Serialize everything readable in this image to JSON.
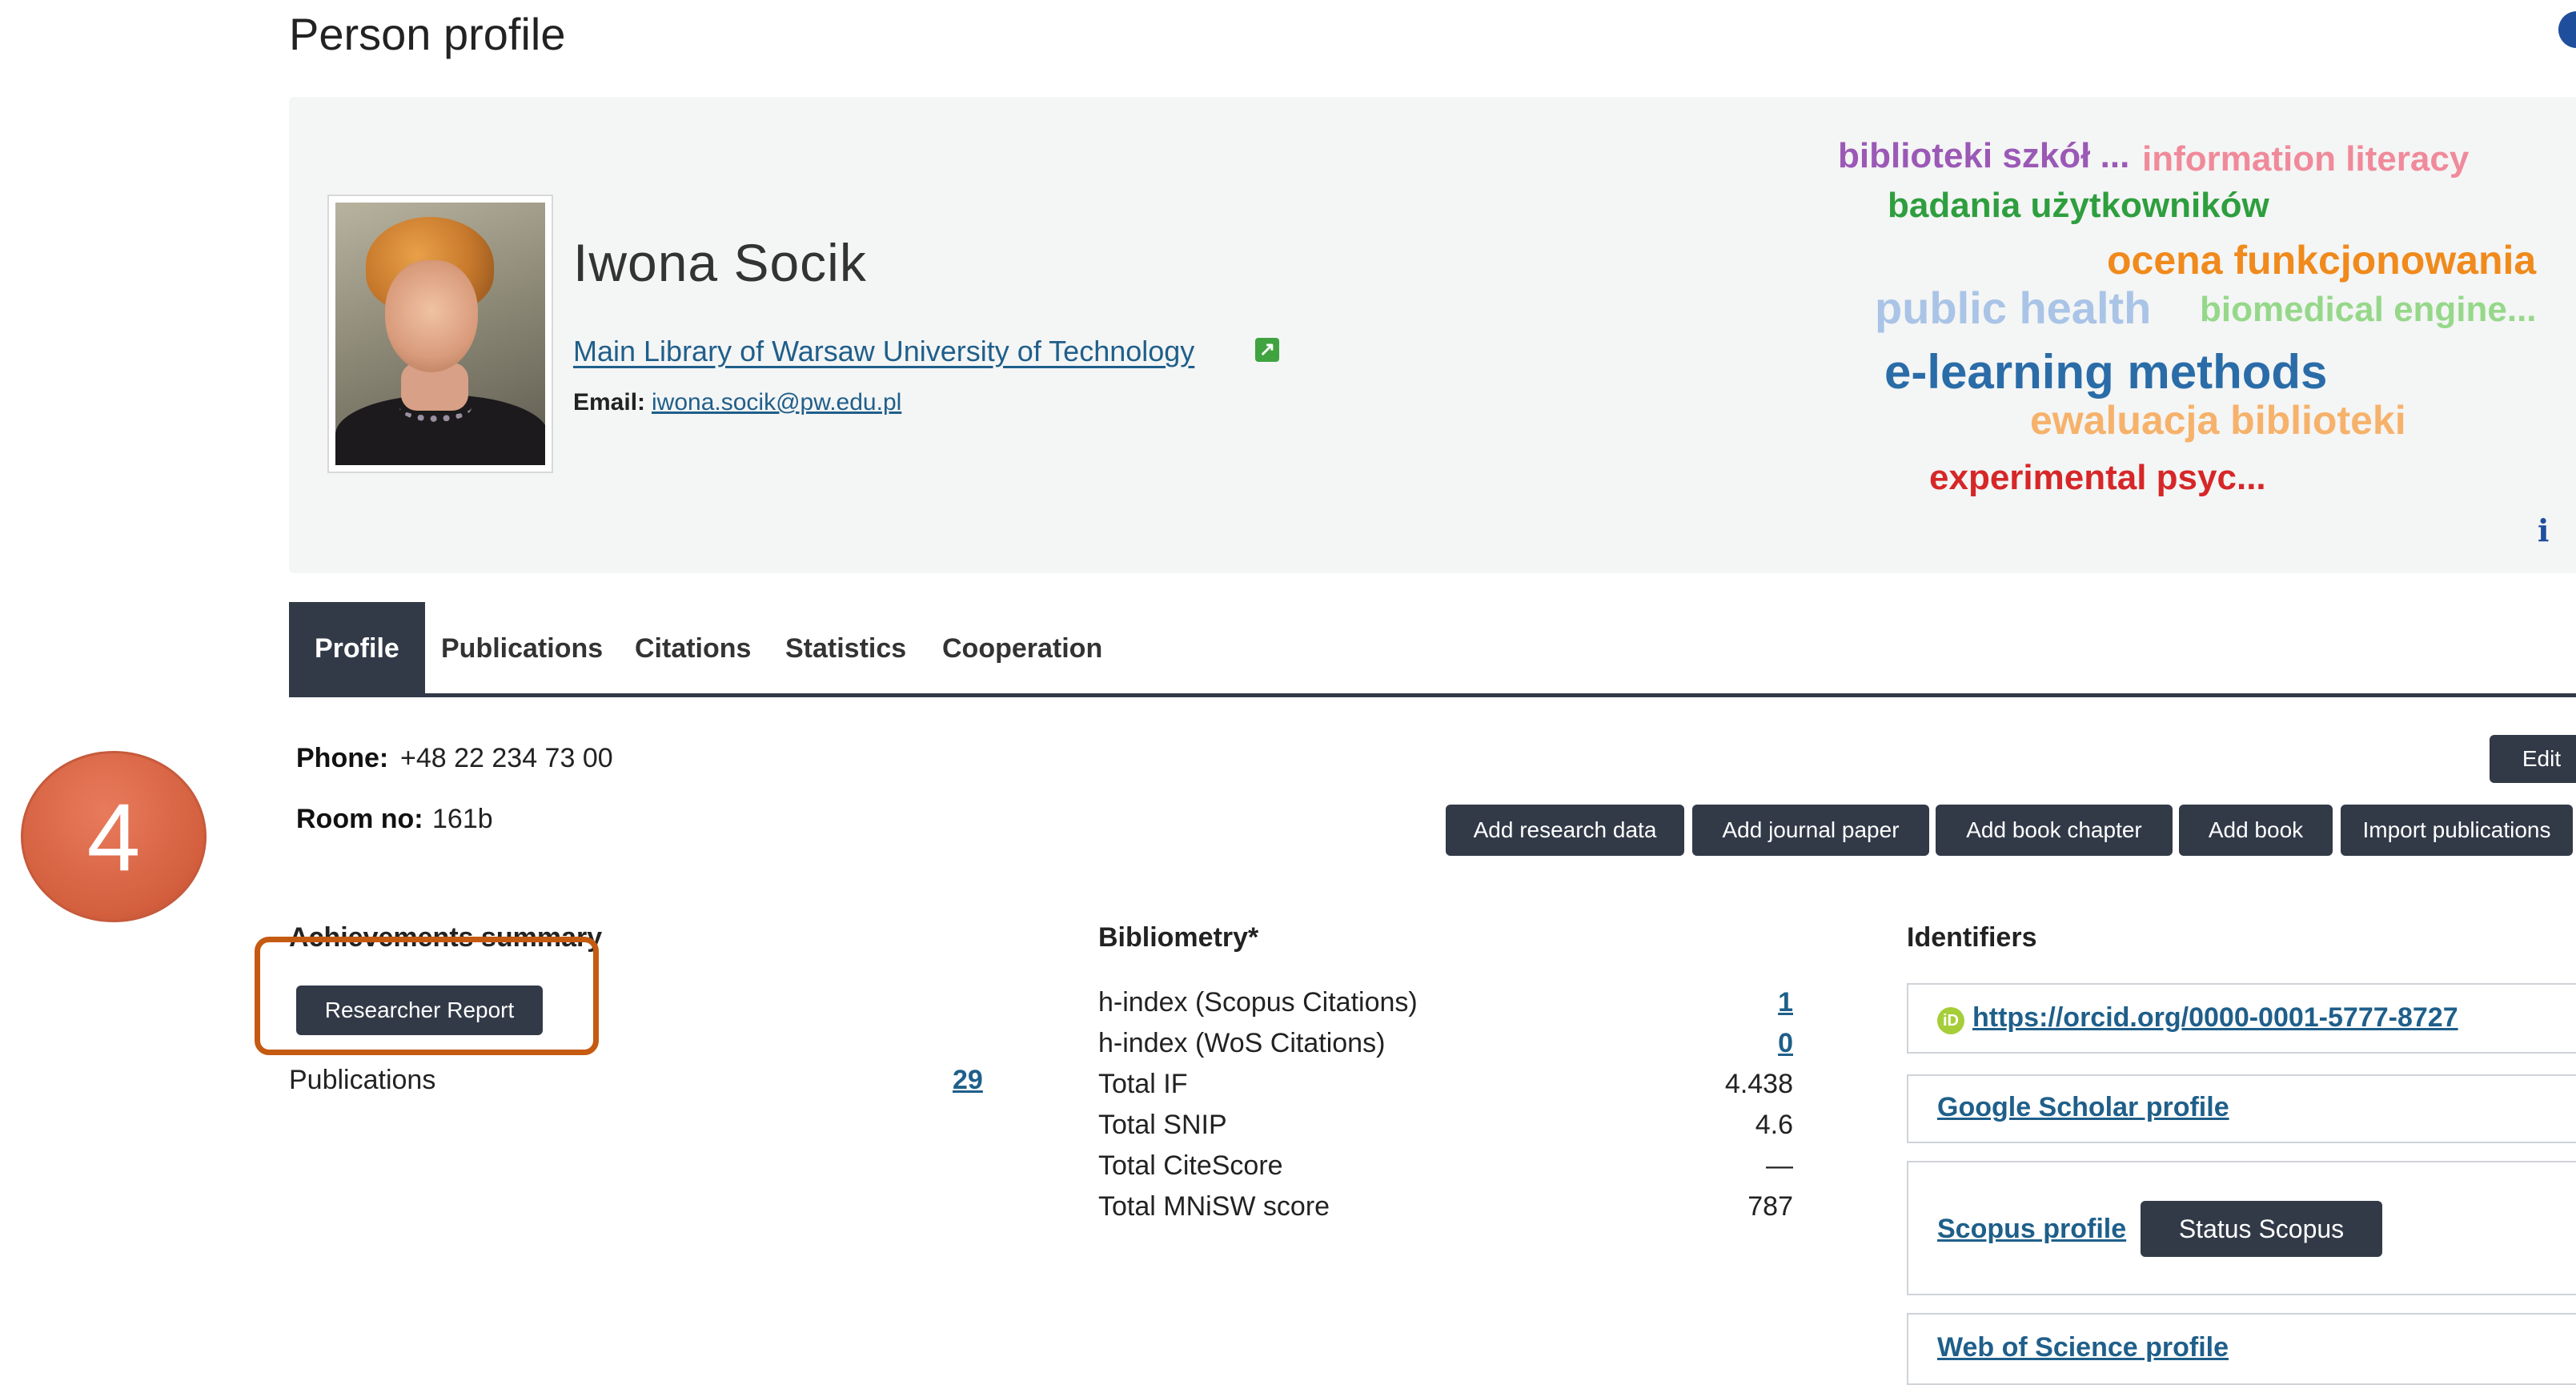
{
  "page": {
    "title": "Person profile"
  },
  "person": {
    "name": "Iwona Socik",
    "affiliation": "Main Library of Warsaw University of Technology",
    "email_label": "Email:",
    "email": "iwona.socik@pw.edu.pl"
  },
  "keywords": [
    {
      "text": "biblioteki szkół ...",
      "color": "#9b59b6"
    },
    {
      "text": "information literacy",
      "color": "#f08a9a"
    },
    {
      "text": "badania użytkowników",
      "color": "#2e9e3e"
    },
    {
      "text": "ocena funkcjonowania",
      "color": "#f08a1c"
    },
    {
      "text": "public health",
      "color": "#a9c4e6"
    },
    {
      "text": "biomedical engine...",
      "color": "#96d88a"
    },
    {
      "text": "e-learning methods",
      "color": "#2a6ca8"
    },
    {
      "text": "ewaluacja biblioteki",
      "color": "#f6b26b"
    },
    {
      "text": "experimental psyc...",
      "color": "#d62728"
    }
  ],
  "tabs": [
    {
      "label": "Profile",
      "active": true
    },
    {
      "label": "Publications"
    },
    {
      "label": "Citations"
    },
    {
      "label": "Statistics"
    },
    {
      "label": "Cooperation"
    }
  ],
  "contact": {
    "phone_label": "Phone:",
    "phone": "+48 22 234 73 00",
    "room_label": "Room no:",
    "room": "161b"
  },
  "actions": {
    "edit": "Edit",
    "add_research_data": "Add research data",
    "add_journal_paper": "Add journal paper",
    "add_book_chapter": "Add book chapter",
    "add_book": "Add book",
    "import_publications": "Import publications"
  },
  "step_marker": "4",
  "achievements": {
    "heading": "Achievements summary",
    "researcher_report": "Researcher Report",
    "publications_label": "Publications",
    "publications_count": "29"
  },
  "bibliometry": {
    "heading": "Bibliometry*",
    "rows": [
      {
        "label": "h-index (Scopus Citations)",
        "value": "1",
        "link": true
      },
      {
        "label": "h-index (WoS Citations)",
        "value": "0",
        "link": true
      },
      {
        "label": "Total IF",
        "value": "4.438"
      },
      {
        "label": "Total SNIP",
        "value": "4.6"
      },
      {
        "label": "Total CiteScore",
        "value": "—"
      },
      {
        "label": "Total MNiSW score",
        "value": "787"
      }
    ]
  },
  "identifiers": {
    "heading": "Identifiers",
    "orcid": "https://orcid.org/0000-0001-5777-8727",
    "google_scholar": "Google Scholar profile",
    "scopus": "Scopus profile",
    "status_scopus": "Status Scopus",
    "wos": "Web of Science profile"
  },
  "icons": {
    "help": "help-icon",
    "external_link": "external-link-icon",
    "info": "info-icon",
    "orcid": "orcid-icon"
  }
}
